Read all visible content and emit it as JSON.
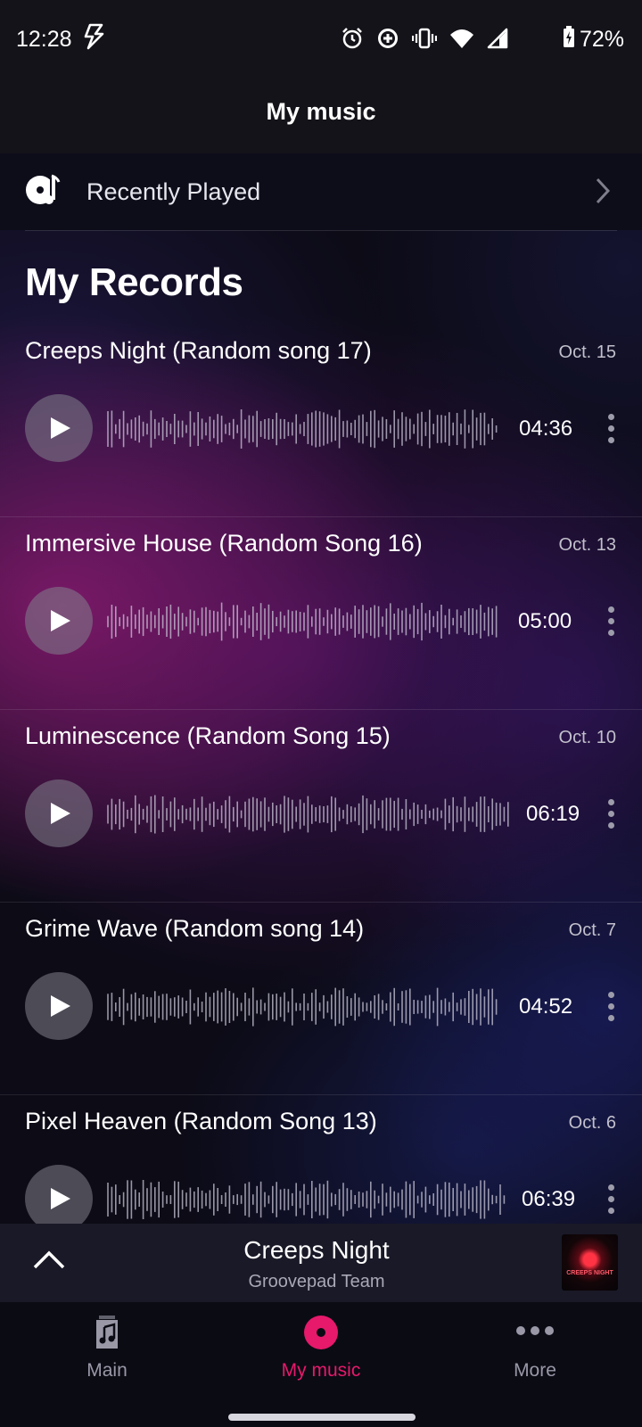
{
  "status_bar": {
    "time": "12:28",
    "battery": "72%",
    "icons": [
      "flash-icon",
      "alarm-icon",
      "data-saver-icon",
      "vibrate-icon",
      "wifi-icon",
      "signal-icon",
      "battery-charging-icon"
    ]
  },
  "header": {
    "title": "My music"
  },
  "recently_played": {
    "label": "Recently Played",
    "icon": "music-note-disc-icon"
  },
  "records_section": {
    "title": "My Records"
  },
  "records": [
    {
      "title": "Creeps Night (Random song 17)",
      "date": "Oct. 15",
      "duration": "04:36"
    },
    {
      "title": "Immersive House (Random Song 16)",
      "date": "Oct. 13",
      "duration": "05:00"
    },
    {
      "title": "Luminescence (Random Song 15)",
      "date": "Oct. 10",
      "duration": "06:19"
    },
    {
      "title": "Grime Wave (Random song 14)",
      "date": "Oct. 7",
      "duration": "04:52"
    },
    {
      "title": "Pixel Heaven (Random Song 13)",
      "date": "Oct. 6",
      "duration": "06:39"
    }
  ],
  "mini_player": {
    "title": "Creeps Night",
    "subtitle": "Groovepad Team",
    "art_text": "CREEPS NIGHT"
  },
  "bottom_nav": [
    {
      "label": "Main",
      "icon": "music-file-icon",
      "active": false
    },
    {
      "label": "My music",
      "icon": "record-disc-icon",
      "active": true
    },
    {
      "label": "More",
      "icon": "more-dots-icon",
      "active": false
    }
  ],
  "colors": {
    "accent": "#e6196b",
    "background": "#0c0b16",
    "header": "#141319",
    "mini_player": "#191927"
  }
}
